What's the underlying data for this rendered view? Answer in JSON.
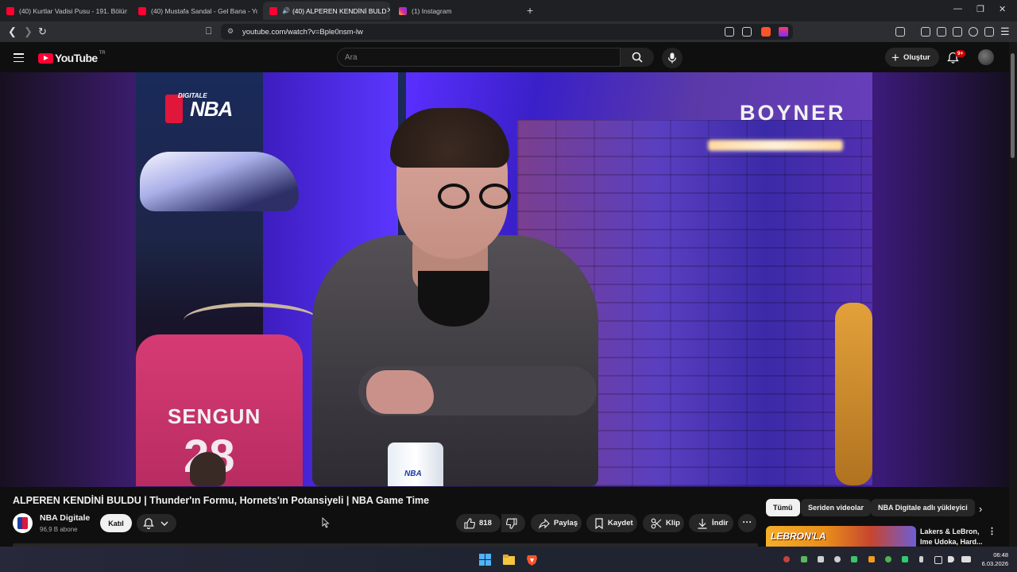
{
  "browser": {
    "tabs": [
      {
        "label": "(40) Kurtlar Vadisi Pusu - 191. Bölüm",
        "favicon": "youtube-icon",
        "active": false
      },
      {
        "label": "(40) Mustafa Sandal - Gel Bana - You",
        "favicon": "youtube-icon",
        "active": false
      },
      {
        "label": "(40) ALPEREN KENDİNİ BULD",
        "favicon": "youtube-icon",
        "active": true
      },
      {
        "label": "(1) Instagram",
        "favicon": "instagram-icon",
        "active": false
      }
    ],
    "url": "youtube.com/watch?v=Bple0nsm-lw"
  },
  "youtube": {
    "logo_text": "YouTube",
    "region": "TR",
    "search_placeholder": "Ara",
    "create_label": "Oluştur",
    "notif_badge": "9+"
  },
  "video": {
    "overlay_logo_small": "DIGITALE",
    "overlay_logo": "NBA",
    "sponsor": "BOYNER",
    "jersey_name": "SENGUN",
    "jersey_number": "28",
    "cup_text": "NBA",
    "title": "ALPEREN KENDİNİ BULDU | Thunder'ın Formu, Hornets'ın Potansiyeli | NBA Game Time"
  },
  "channel": {
    "name": "NBA Digitale",
    "subscribers": "96,9 B abone",
    "join_label": "Katıl"
  },
  "actions": {
    "likes": "818",
    "share": "Paylaş",
    "save": "Kaydet",
    "clip": "Klip",
    "download": "İndir"
  },
  "chips": [
    "Tümü",
    "Seriden videolar",
    "NBA Digitale adlı yükleyici"
  ],
  "recommendation": {
    "thumb_text": "LEBRON'LA",
    "title_line1": "Lakers & LeBron,",
    "title_line2": "Ime Udoka, Hard..."
  },
  "taskbar": {
    "time": "06:48",
    "date": "6.03.2026"
  },
  "colors": {
    "youtube_red": "#ff0033",
    "page_bg": "#0f0f0f"
  }
}
